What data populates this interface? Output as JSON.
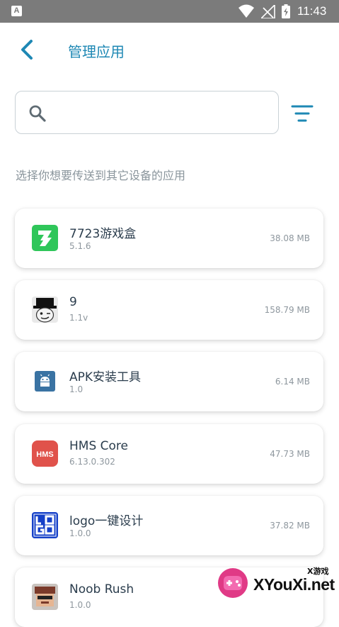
{
  "status_bar": {
    "left_icon_letter": "A",
    "time": "11:43",
    "icons": [
      "wifi-icon",
      "no-signal-icon",
      "battery-charging-icon"
    ]
  },
  "header": {
    "back_icon": "chevron-left-icon",
    "title": "管理应用"
  },
  "search": {
    "value": "",
    "placeholder": "",
    "icon": "search-icon",
    "filter_icon": "filter-icon"
  },
  "hint": "选择你想要传送到其它设备的应用",
  "apps": [
    {
      "name": "7723游戏盒",
      "version": "5.1.6",
      "size": "38.08 MB",
      "icon": "7723-icon"
    },
    {
      "name": "9",
      "version": "1.1v",
      "size": "158.79 MB",
      "icon": "top-hat-face-icon"
    },
    {
      "name": "APK安装工具",
      "version": "1.0",
      "size": "6.14 MB",
      "icon": "android-installer-icon"
    },
    {
      "name": "HMS Core",
      "version": "6.13.0.302",
      "size": "47.73 MB",
      "icon": "hms-icon"
    },
    {
      "name": "logo一键设计",
      "version": "1.0.0",
      "size": "37.82 MB",
      "icon": "logo-design-icon"
    },
    {
      "name": "Noob Rush",
      "version": "1.0.0",
      "size": "",
      "icon": "noob-rush-icon"
    }
  ],
  "watermark": {
    "small": "X游戏",
    "text": "XYouXi.net"
  },
  "colors": {
    "accent": "#1e88b4",
    "status_bar": "#7b7b7b",
    "hint": "#8a959c"
  }
}
